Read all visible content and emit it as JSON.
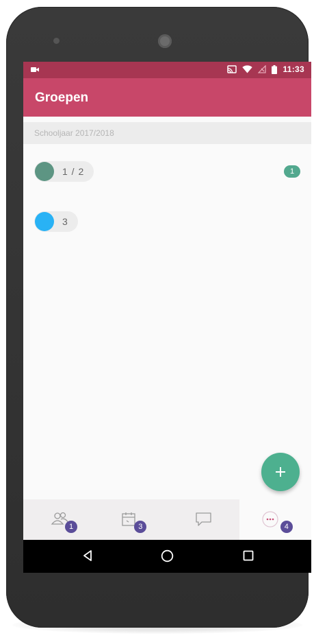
{
  "status_bar": {
    "time": "11:33",
    "icons": [
      "video-camera-icon",
      "cast-icon",
      "wifi-icon",
      "signal-off-icon",
      "battery-icon"
    ]
  },
  "app_bar": {
    "title": "Groepen"
  },
  "section": {
    "label": "Schooljaar 2017/2018"
  },
  "groups": [
    {
      "label": "1 / 2",
      "color": "#5d9583",
      "badge": "1"
    },
    {
      "label": "3",
      "color": "#29b2f5",
      "badge": ""
    }
  ],
  "fab": {
    "icon": "plus-icon"
  },
  "bottom_nav": [
    {
      "icon": "groups-icon",
      "badge": "1"
    },
    {
      "icon": "calendar-icon",
      "badge": "3"
    },
    {
      "icon": "chat-icon",
      "badge": ""
    },
    {
      "icon": "more-icon",
      "badge": "4",
      "active": true
    }
  ],
  "system_nav": [
    "back-icon",
    "home-icon",
    "recents-icon"
  ],
  "colors": {
    "status_bar": "#a73652",
    "app_bar": "#c84769",
    "fab": "#4db08f",
    "nav_badge": "#5b4d99",
    "count_badge": "#52a88e"
  }
}
